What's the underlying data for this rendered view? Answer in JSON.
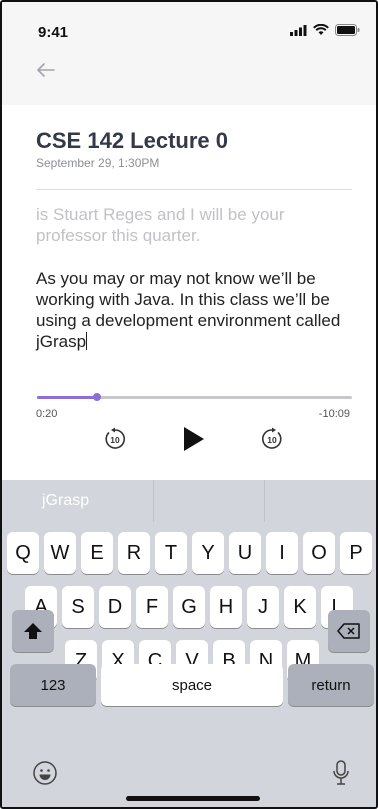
{
  "status": {
    "time": "9:41"
  },
  "note": {
    "title": "CSE 142 Lecture 0",
    "date": "September 29, 1:30PM",
    "faded_text": "is Stuart Reges and I will be your professor this quarter.",
    "current_text": "As you may or may not know we’ll be working with Java. In this class we’ll be using a development environment called jGrasp"
  },
  "player": {
    "elapsed": "0:20",
    "remaining": "-10:09",
    "progress": 0.19,
    "skip_back_seconds": "10",
    "skip_forward_seconds": "10"
  },
  "keyboard": {
    "suggestions": [
      "jGrasp",
      "",
      ""
    ],
    "row1": [
      "Q",
      "W",
      "E",
      "R",
      "T",
      "Y",
      "U",
      "I",
      "O",
      "P"
    ],
    "row2": [
      "A",
      "S",
      "D",
      "F",
      "G",
      "H",
      "J",
      "K",
      "L"
    ],
    "row3": [
      "Z",
      "X",
      "C",
      "V",
      "B",
      "N",
      "M"
    ],
    "numbers_label": "123",
    "space_label": "space",
    "return_label": "return"
  },
  "colors": {
    "accent": "#8b6fd6",
    "keyboard_bg": "#d2d5db"
  }
}
